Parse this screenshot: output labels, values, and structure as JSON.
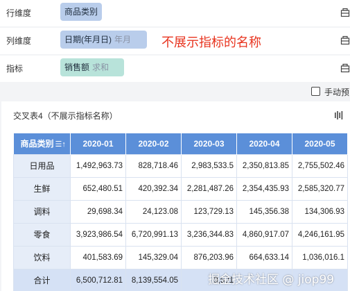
{
  "dimensions": {
    "row": {
      "label": "行维度",
      "chip": "商品类别"
    },
    "column": {
      "label": "列维度",
      "chip": "日期(年月日)",
      "chip_sub": "年月"
    },
    "metric": {
      "label": "指标",
      "chip": "销售额",
      "chip_sub": "求和"
    }
  },
  "annotation": "不展示指标的名称",
  "manual_refresh": {
    "label": "手动预",
    "checked": false
  },
  "table": {
    "title": "交叉表4（不展示指标名称）",
    "corner_header": "商品类别",
    "corner_icon": "sort-icon",
    "columns": [
      "2020-01",
      "2020-02",
      "2020-03",
      "2020-04",
      "2020-05"
    ],
    "rows": [
      {
        "name": "日用品",
        "values": [
          "1,492,963.73",
          "828,718.46",
          "2,983,533.5",
          "2,350,813.85",
          "2,755,502.46"
        ]
      },
      {
        "name": "生鲜",
        "values": [
          "652,480.51",
          "420,392.34",
          "2,281,487.26",
          "2,354,435.93",
          "2,585,320.77"
        ]
      },
      {
        "name": "调料",
        "values": [
          "29,698.34",
          "24,123.08",
          "123,729.13",
          "145,356.38",
          "134,306.93"
        ]
      },
      {
        "name": "零食",
        "values": [
          "3,923,986.54",
          "6,720,991.13",
          "3,236,344.83",
          "4,860,917.07",
          "4,246,161.95"
        ]
      },
      {
        "name": "饮料",
        "values": [
          "401,583.69",
          "145,329.04",
          "876,203.96",
          "664,633.14",
          "1,036,016.1"
        ]
      },
      {
        "name": "合计",
        "values": [
          "6,500,712.81",
          "8,139,554.05",
          "9,501",
          "",
          ""
        ]
      }
    ]
  },
  "watermark": "掘金技术社区 @ jiop99",
  "colors": {
    "header_blue": "#5b8fd9",
    "chip_blue": "#b9cdeb",
    "chip_teal": "#b8e3da",
    "annotation_red": "#e8341f",
    "row_head_bg": "#e6edf8",
    "total_bg": "#d5e1f5"
  }
}
